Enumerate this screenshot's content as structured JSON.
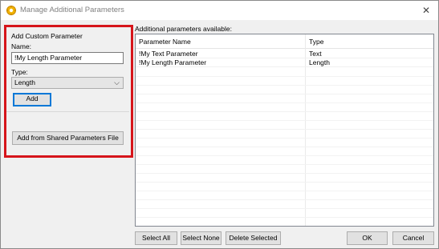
{
  "window": {
    "title": "Manage Additional Parameters"
  },
  "custom_parameter": {
    "group_title": "Add Custom Parameter",
    "name_label": "Name:",
    "name_value": "!My Length Parameter",
    "type_label": "Type:",
    "type_value": "Length",
    "add_label": "Add",
    "shared_file_label": "Add from Shared Parameters File"
  },
  "available": {
    "label": "Additional parameters available:",
    "columns": [
      "Parameter Name",
      "Type"
    ],
    "rows": [
      {
        "name": "!My Text Parameter",
        "type": "Text"
      },
      {
        "name": "!My Length Parameter",
        "type": "Length"
      }
    ]
  },
  "buttons": {
    "select_all": "Select All",
    "select_none": "Select None",
    "delete_selected": "Delete Selected",
    "ok": "OK",
    "cancel": "Cancel"
  },
  "colors": {
    "highlight": "#d6151b",
    "focus": "#0078d7"
  },
  "icons": {
    "app": "revit-gear-icon",
    "close": "close-icon",
    "dropdown": "chevron-down-icon"
  }
}
